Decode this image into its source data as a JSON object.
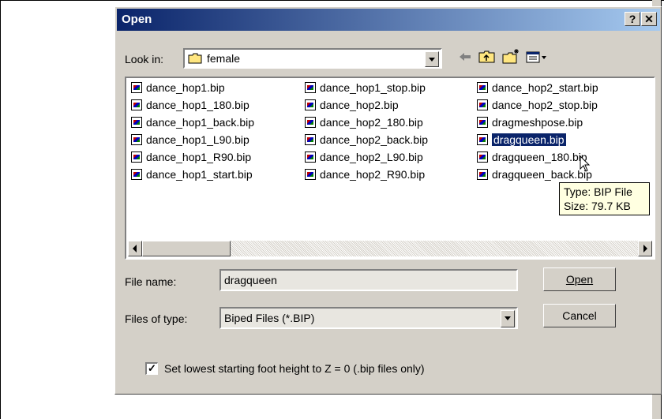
{
  "dialog": {
    "title": "Open",
    "help_label": "?",
    "close_label": "✕"
  },
  "look_in": {
    "label": "Look in:",
    "value": "female"
  },
  "files": [
    {
      "name": "dance_hop1.bip"
    },
    {
      "name": "dance_hop1_180.bip"
    },
    {
      "name": "dance_hop1_back.bip"
    },
    {
      "name": "dance_hop1_L90.bip"
    },
    {
      "name": "dance_hop1_R90.bip"
    },
    {
      "name": "dance_hop1_start.bip"
    },
    {
      "name": "dance_hop1_stop.bip"
    },
    {
      "name": "dance_hop2.bip"
    },
    {
      "name": "dance_hop2_180.bip"
    },
    {
      "name": "dance_hop2_back.bip"
    },
    {
      "name": "dance_hop2_L90.bip"
    },
    {
      "name": "dance_hop2_R90.bip"
    },
    {
      "name": "dance_hop2_start.bip"
    },
    {
      "name": "dance_hop2_stop.bip"
    },
    {
      "name": "dragmeshpose.bip"
    },
    {
      "name": "dragqueen.bip",
      "selected": true
    },
    {
      "name": "dragqueen_180.bip"
    },
    {
      "name": "dragqueen_back.bip"
    }
  ],
  "tooltip": {
    "line1": "Type: BIP File",
    "line2": "Size: 79.7 KB"
  },
  "file_name": {
    "label": "File name:",
    "value": "dragqueen"
  },
  "file_type": {
    "label": "Files of type:",
    "value": "Biped Files (*.BIP)"
  },
  "buttons": {
    "open": "Open",
    "cancel": "Cancel"
  },
  "option": {
    "checked": true,
    "label": "Set lowest starting foot height to Z = 0 (.bip files only)"
  },
  "colors": {
    "title_start": "#0a246a",
    "title_end": "#a6caf0",
    "selection": "#0a246a",
    "face": "#d4d0c8"
  }
}
